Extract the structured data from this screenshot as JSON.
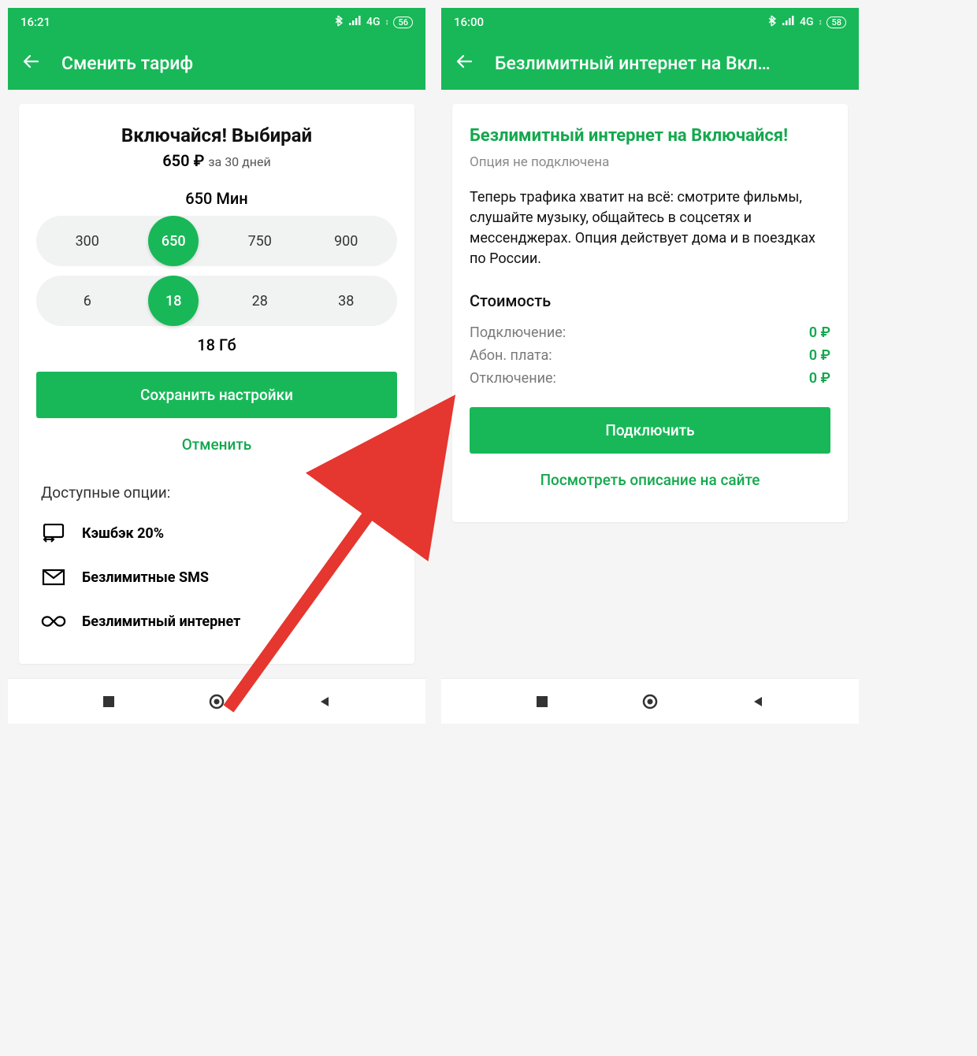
{
  "left": {
    "status": {
      "time": "16:21",
      "network": "4G",
      "battery": "56"
    },
    "appbar": {
      "title": "Сменить тариф"
    },
    "tariff": {
      "name": "Включайся! Выбирай",
      "price": "650 ₽",
      "period": "за 30 дней",
      "minutes": {
        "label": "650 Мин",
        "options": [
          "300",
          "650",
          "750",
          "900"
        ],
        "selected": "650"
      },
      "gb": {
        "label": "18 Гб",
        "options": [
          "6",
          "18",
          "28",
          "38"
        ],
        "selected": "18"
      },
      "save": "Сохранить настройки",
      "cancel": "Отменить"
    },
    "options": {
      "heading": "Доступные опции:",
      "items": [
        {
          "label": "Кэшбэк 20%"
        },
        {
          "label": "Безлимитные SMS"
        },
        {
          "label": "Безлимитный интернет"
        }
      ]
    }
  },
  "right": {
    "status": {
      "time": "16:00",
      "network": "4G",
      "battery": "58"
    },
    "appbar": {
      "title": "Безлимитный интернет на Вкл…"
    },
    "card": {
      "title": "Безлимитный интернет на Включайся!",
      "subtitle": "Опция не подключена",
      "desc": "Теперь трафика хватит на всё: смотрите фильмы, слушайте музыку, общайтесь в соцсетях и мессенджерах. Опция действует дома и в поездках по России.",
      "costHeading": "Стоимость",
      "rows": [
        {
          "lab": "Подключение:",
          "val": "0 ₽"
        },
        {
          "lab": "Абон. плата:",
          "val": "0 ₽"
        },
        {
          "lab": "Отключение:",
          "val": "0 ₽"
        }
      ],
      "connect": "Подключить",
      "link": "Посмотреть описание на сайте"
    }
  }
}
